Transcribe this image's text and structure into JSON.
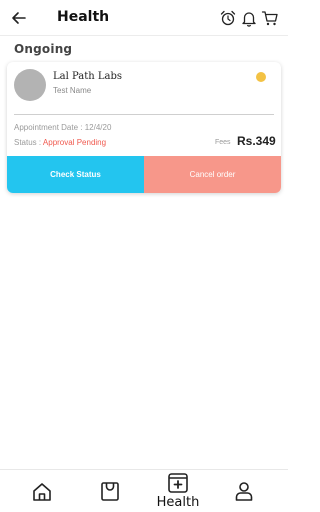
{
  "header": {
    "title": "Health",
    "back_icon": "arrow-left-icon",
    "icons": [
      "alarm-clock-icon",
      "bell-icon",
      "cart-icon"
    ]
  },
  "section": {
    "title": "Ongoing"
  },
  "order": {
    "lab_name": "Lal Path Labs",
    "test_name": "Test Name",
    "status_dot_color": "#f3c244",
    "appointment_label": "Appointment Date : 12/4/20",
    "status_label": "Status :",
    "status_value": "Approval Pending",
    "fees_label": "Fees",
    "fees_value": "Rs.349",
    "check_status_label": "Check Status",
    "cancel_label": "Cancel order"
  },
  "colors": {
    "check_status": "#23c5ef",
    "cancel": "#f7978a",
    "status_pending": "#f05a4f"
  },
  "bottom_nav": {
    "items": [
      {
        "icon": "home-icon",
        "label": ""
      },
      {
        "icon": "shopping-bag-icon",
        "label": ""
      },
      {
        "icon": "medical-plus-icon",
        "label": "Health",
        "active": true
      },
      {
        "icon": "user-icon",
        "label": ""
      }
    ]
  }
}
